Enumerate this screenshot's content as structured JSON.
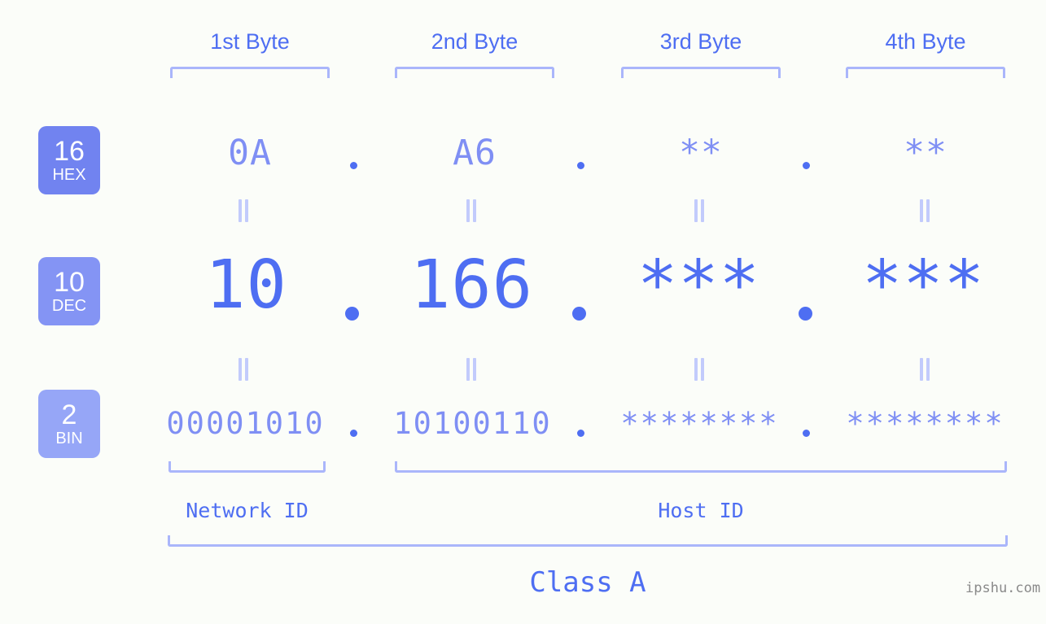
{
  "meta": {
    "background_color": "#fbfdf9",
    "accent_color": "#4e6ef2",
    "accent_light_color": "#7f8ff4",
    "bracket_color": "#aab6fb",
    "equals_color": "#c2cbfc",
    "watermark": "ipshu.com"
  },
  "headers": {
    "byte1": "1st Byte",
    "byte2": "2nd Byte",
    "byte3": "3rd Byte",
    "byte4": "4th Byte"
  },
  "rows": [
    {
      "id": "hex",
      "badge_number": "16",
      "badge_system": "HEX",
      "badge_color": "#7183f0",
      "values": [
        "0A",
        "A6",
        "**",
        "**"
      ],
      "separator": "."
    },
    {
      "id": "dec",
      "badge_number": "10",
      "badge_system": "DEC",
      "badge_color": "#8494f4",
      "values": [
        "10",
        "166",
        "***",
        "***"
      ],
      "separator": "."
    },
    {
      "id": "bin",
      "badge_number": "2",
      "badge_system": "BIN",
      "badge_color": "#96a6f7",
      "values": [
        "00001010",
        "10100110",
        "********",
        "********"
      ],
      "separator": "."
    }
  ],
  "equals_marker": "=",
  "footer": {
    "network_id": "Network ID",
    "host_id": "Host ID",
    "class": "Class A"
  }
}
